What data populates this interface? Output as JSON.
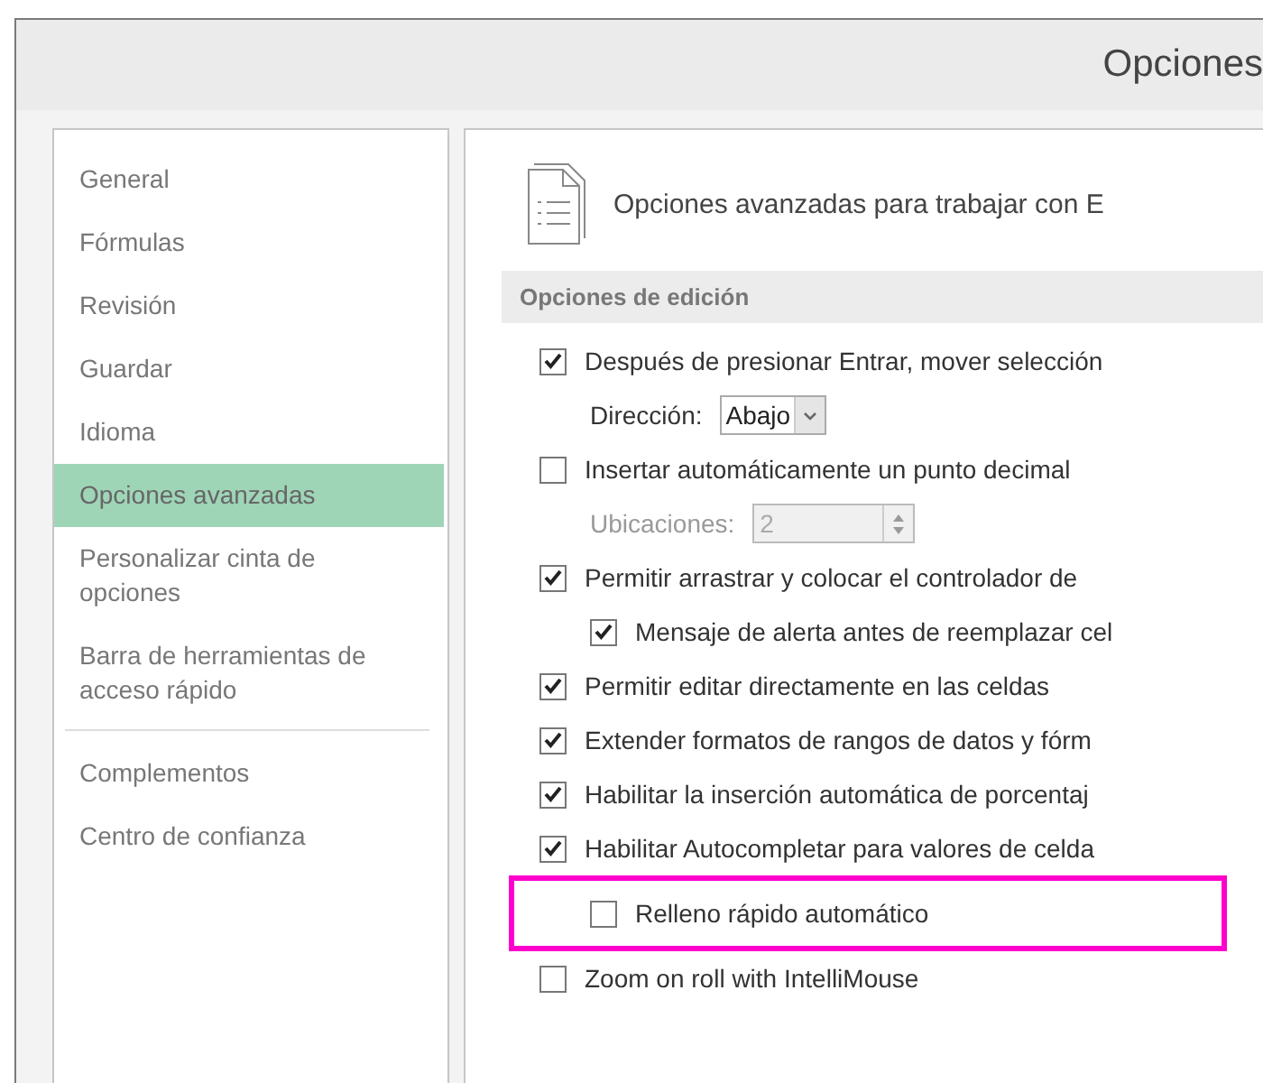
{
  "window": {
    "title": "Opciones"
  },
  "sidebar": {
    "items": [
      {
        "label": "General",
        "selected": false
      },
      {
        "label": "Fórmulas",
        "selected": false
      },
      {
        "label": "Revisión",
        "selected": false
      },
      {
        "label": "Guardar",
        "selected": false
      },
      {
        "label": "Idioma",
        "selected": false
      },
      {
        "label": "Opciones avanzadas",
        "selected": true
      },
      {
        "label": "Personalizar cinta de opciones",
        "selected": false
      },
      {
        "label": "Barra de herramientas de acceso rápido",
        "selected": false,
        "divider_after": true
      },
      {
        "label": "Complementos",
        "selected": false
      },
      {
        "label": "Centro de confianza",
        "selected": false
      }
    ]
  },
  "header": {
    "text": "Opciones avanzadas para trabajar con E"
  },
  "section": {
    "title": "Opciones de edición",
    "options": [
      {
        "kind": "checkbox",
        "label": "Después de presionar Entrar, mover selección",
        "checked": true,
        "children": [
          {
            "kind": "dropdown",
            "label": "Dirección:",
            "value": "Abajo"
          }
        ]
      },
      {
        "kind": "checkbox",
        "label": "Insertar automáticamente un punto decimal",
        "checked": false,
        "children": [
          {
            "kind": "spinner",
            "label": "Ubicaciones:",
            "value": "2",
            "disabled": true
          }
        ]
      },
      {
        "kind": "checkbox",
        "label": "Permitir arrastrar y colocar el controlador de",
        "checked": true,
        "children": [
          {
            "kind": "checkbox",
            "label": "Mensaje de alerta antes de reemplazar cel",
            "checked": true
          }
        ]
      },
      {
        "kind": "checkbox",
        "label": "Permitir editar directamente en las celdas",
        "checked": true
      },
      {
        "kind": "checkbox",
        "label": "Extender formatos de rangos de datos y fórm",
        "checked": true
      },
      {
        "kind": "checkbox",
        "label": "Habilitar la inserción automática de porcentaj",
        "checked": true
      },
      {
        "kind": "checkbox",
        "label": "Habilitar Autocompletar para valores de celda",
        "checked": true,
        "children": [
          {
            "kind": "checkbox",
            "label": "Relleno rápido automático",
            "checked": false,
            "highlighted": true
          }
        ]
      },
      {
        "kind": "checkbox",
        "label": "Zoom on roll with IntelliMouse",
        "checked": false
      }
    ]
  }
}
